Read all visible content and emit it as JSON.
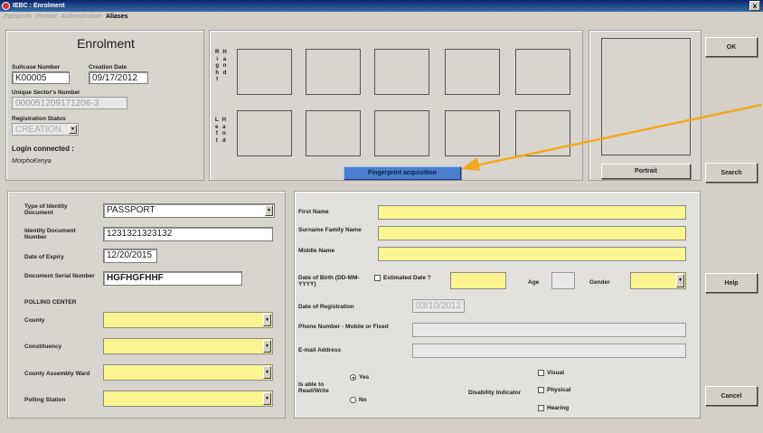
{
  "window": {
    "title": "IEBC : Enrolment",
    "close_glyph": "x"
  },
  "menu": [
    {
      "label": "Passports"
    },
    {
      "label": "Portrait"
    },
    {
      "label": "Authentication"
    },
    {
      "label": "Aliases",
      "active": true
    }
  ],
  "left_panel": {
    "heading": "Enrolment",
    "suitcase_label": "Suitcase Number",
    "suitcase_value": "K00005",
    "creation_label": "Creation Date",
    "creation_value": "09/17/2012",
    "sector_label": "Unique Sector's Number",
    "sector_value": "000051209171206-3",
    "status_label": "Registration Status",
    "status_value": "CREATION",
    "login_label": "Login connected :",
    "login_value": "MorphoKenya"
  },
  "fingerprint": {
    "right_letters": [
      [
        "R",
        "i",
        "g",
        "h",
        "t"
      ],
      [
        "H",
        "a",
        "n",
        "d"
      ]
    ],
    "left_letters": [
      [
        "L",
        "e",
        "f",
        "t"
      ],
      [
        "H",
        "a",
        "n",
        "d"
      ]
    ],
    "button": "Fingerprint acquisition"
  },
  "portrait": {
    "button": "Portrait"
  },
  "side_buttons": {
    "ok": "OK",
    "search": "Search",
    "help": "Help",
    "cancel": "Cancel"
  },
  "identity": {
    "doc_type_label": "Type of Identity Document",
    "doc_type_value": "PASSPORT",
    "doc_number_label": "Identity Document Number",
    "doc_number_value": "1231321323132",
    "expiry_label": "Date of Expiry",
    "expiry_value": "12/20/2015",
    "serial_label": "Document Serial Number",
    "serial_value": "HGFHGFHHF",
    "polling_heading": "POLLING CENTER",
    "county_label": "County",
    "constituency_label": "Constituency",
    "ward_label": "County Assembly Ward",
    "station_label": "Polling Station"
  },
  "person": {
    "first_name_label": "First Name",
    "surname_label": "Surname Family Name",
    "middle_name_label": "Middle Name",
    "dob_label": "Date of Birth (DD-MM-YYYY)",
    "estimated_label": "Estimated Date ?",
    "age_label": "Age",
    "gender_label": "Gender",
    "registration_date_label": "Date of Registration",
    "registration_date_value": "03/10/2012",
    "phone_label": "Phone Number - Mobile or Fixed",
    "email_label": "E-mail Address",
    "read_write_label": "Is able to Read/Write",
    "yes_label": "Yes",
    "no_label": "No",
    "disability_label": "Disability Indicator",
    "visual_label": "Visual",
    "physical_label": "Physical",
    "hearing_label": "Hearing"
  },
  "colors": {
    "required_field": "#fbf590",
    "arrow": "#f2a81e",
    "accent_button": "#4a7fd0"
  }
}
